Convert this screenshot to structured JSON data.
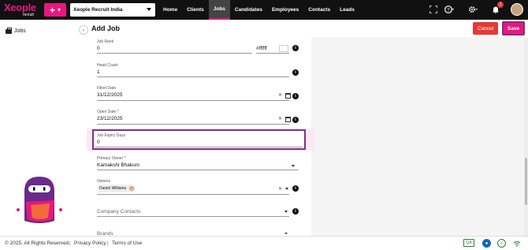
{
  "topbar": {
    "logo_main": "Xeople",
    "logo_sub": "recruit",
    "org_selected": "Xeople Recruit India",
    "nav": [
      "Home",
      "Clients",
      "Jobs",
      "Candidates",
      "Employees",
      "Contacts",
      "Leads"
    ],
    "active_nav": "Jobs",
    "notification_count": "1",
    "icons": [
      "add-icon",
      "fullscreen-icon",
      "help-icon",
      "gear-icon",
      "bell-icon",
      "avatar"
    ]
  },
  "sidebar": {
    "jobs_label": "Jobs"
  },
  "header": {
    "title": "Add Job",
    "cancel_label": "Cancel",
    "save_label": "Save"
  },
  "form": {
    "job_rank": {
      "label": "Job Rank",
      "value": "0",
      "color_value": "#ffffff"
    },
    "head_count": {
      "label": "Head Count",
      "value": "1"
    },
    "filled_date": {
      "label": "Filled Date",
      "value": "31/12/2025"
    },
    "open_date": {
      "label": "Open Date *",
      "value": "23/12/2025"
    },
    "job_expiry_days": {
      "label": "Job Expiry Days",
      "value": "0"
    },
    "primary_owner": {
      "label": "Primary Owner *",
      "value": "Kamakshi Bhakuni"
    },
    "owners": {
      "label": "Owners",
      "chips": [
        "Daniel Williams"
      ]
    },
    "company_contacts": {
      "label": "Company Contacts",
      "value": ""
    },
    "brands": {
      "label": "Brands",
      "value": ""
    }
  },
  "footer": {
    "copyright": "© 2025. All Rights Reserved",
    "links": [
      "Privacy Policy",
      "Terms of Use"
    ],
    "env_badge": "QA"
  },
  "colors": {
    "brand": "#e8177d",
    "topbar": "#111111",
    "cancel": "#e53935",
    "highlight": "#8a2a8a"
  }
}
